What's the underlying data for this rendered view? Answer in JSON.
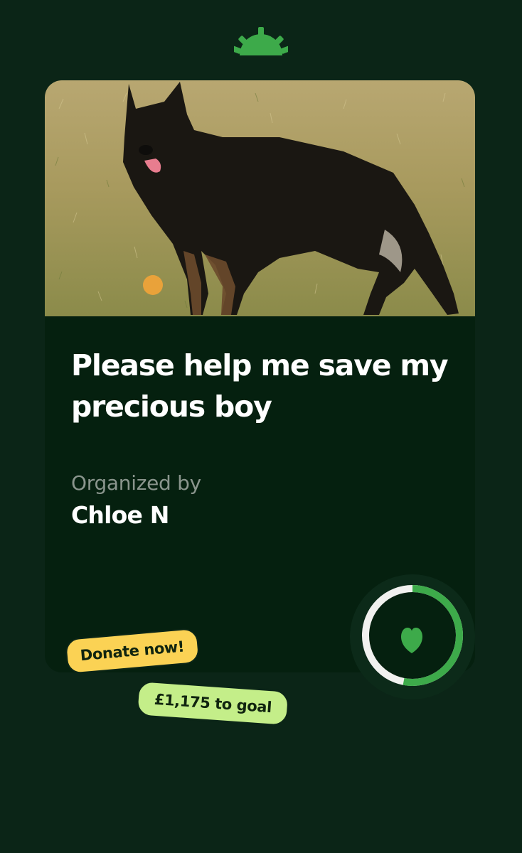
{
  "campaign": {
    "title": "Please help me save my precious boy",
    "organizer_label": "Organized by",
    "organizer_name": "Chloe N",
    "progress_fraction": 0.53
  },
  "actions": {
    "donate_label": "Donate now!",
    "goal_remaining": "£1,175 to goal"
  },
  "icons": {
    "logo": "sunrise-logo-icon",
    "heart": "heart-icon"
  },
  "colors": {
    "background": "#0b2517",
    "card": "#05200f",
    "brand_green": "#3daa4a",
    "donate_yellow": "#fbd254",
    "goal_green": "#c4ee89"
  }
}
